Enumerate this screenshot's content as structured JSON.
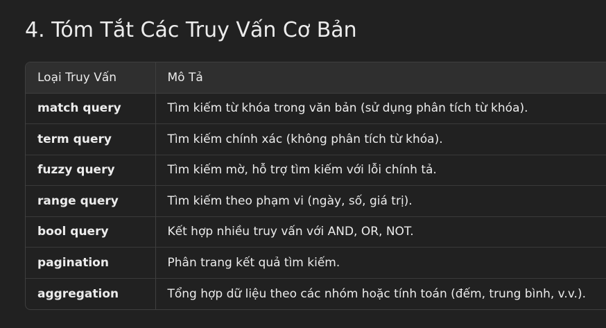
{
  "title": "4. Tóm Tắt Các Truy Vấn Cơ Bản",
  "table": {
    "headers": [
      "Loại Truy Vấn",
      "Mô Tả"
    ],
    "rows": [
      {
        "type": "match query",
        "desc": "Tìm kiếm từ khóa trong văn bản (sử dụng phân tích từ khóa)."
      },
      {
        "type": "term query",
        "desc": "Tìm kiếm chính xác (không phân tích từ khóa)."
      },
      {
        "type": "fuzzy query",
        "desc": "Tìm kiếm mờ, hỗ trợ tìm kiếm với lỗi chính tả."
      },
      {
        "type": "range query",
        "desc": "Tìm kiếm theo phạm vi (ngày, số, giá trị)."
      },
      {
        "type": "bool query",
        "desc": "Kết hợp nhiều truy vấn với AND, OR, NOT."
      },
      {
        "type": "pagination",
        "desc": "Phân trang kết quả tìm kiếm."
      },
      {
        "type": "aggregation",
        "desc": "Tổng hợp dữ liệu theo các nhóm hoặc tính toán (đếm, trung bình, v.v.)."
      }
    ]
  }
}
